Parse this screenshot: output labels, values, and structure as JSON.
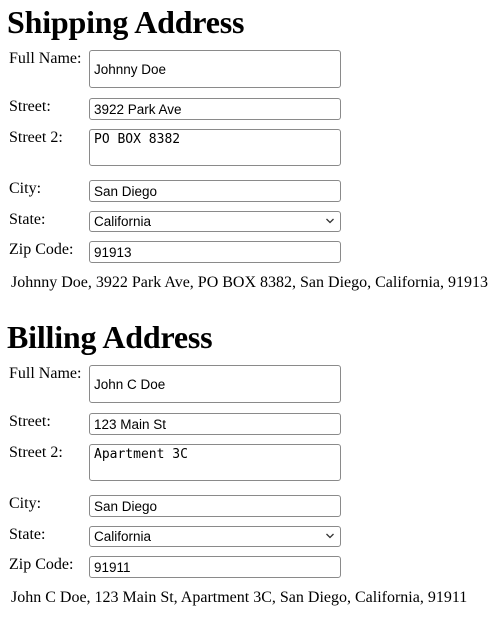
{
  "shipping": {
    "title": "Shipping Address",
    "labels": {
      "full_name": "Full Name:",
      "street": "Street:",
      "street2": "Street 2:",
      "city": "City:",
      "state": "State:",
      "zip": "Zip Code:"
    },
    "values": {
      "full_name": "Johnny Doe",
      "street": "3922 Park Ave",
      "street2": "PO BOX 8382",
      "city": "San Diego",
      "state": "California",
      "zip": "91913"
    },
    "summary": "Johnny Doe, 3922 Park Ave, PO BOX 8382, San Diego, California, 91913"
  },
  "billing": {
    "title": "Billing Address",
    "labels": {
      "full_name": "Full Name:",
      "street": "Street:",
      "street2": "Street 2:",
      "city": "City:",
      "state": "State:",
      "zip": "Zip Code:"
    },
    "values": {
      "full_name": "John C Doe",
      "street": "123 Main St",
      "street2": "Apartment 3C",
      "city": "San Diego",
      "state": "California",
      "zip": "91911"
    },
    "summary": "John C Doe, 123 Main St, Apartment 3C, San Diego, California, 91911"
  },
  "icons": {
    "select_arrow": "chevron-down-icon"
  }
}
